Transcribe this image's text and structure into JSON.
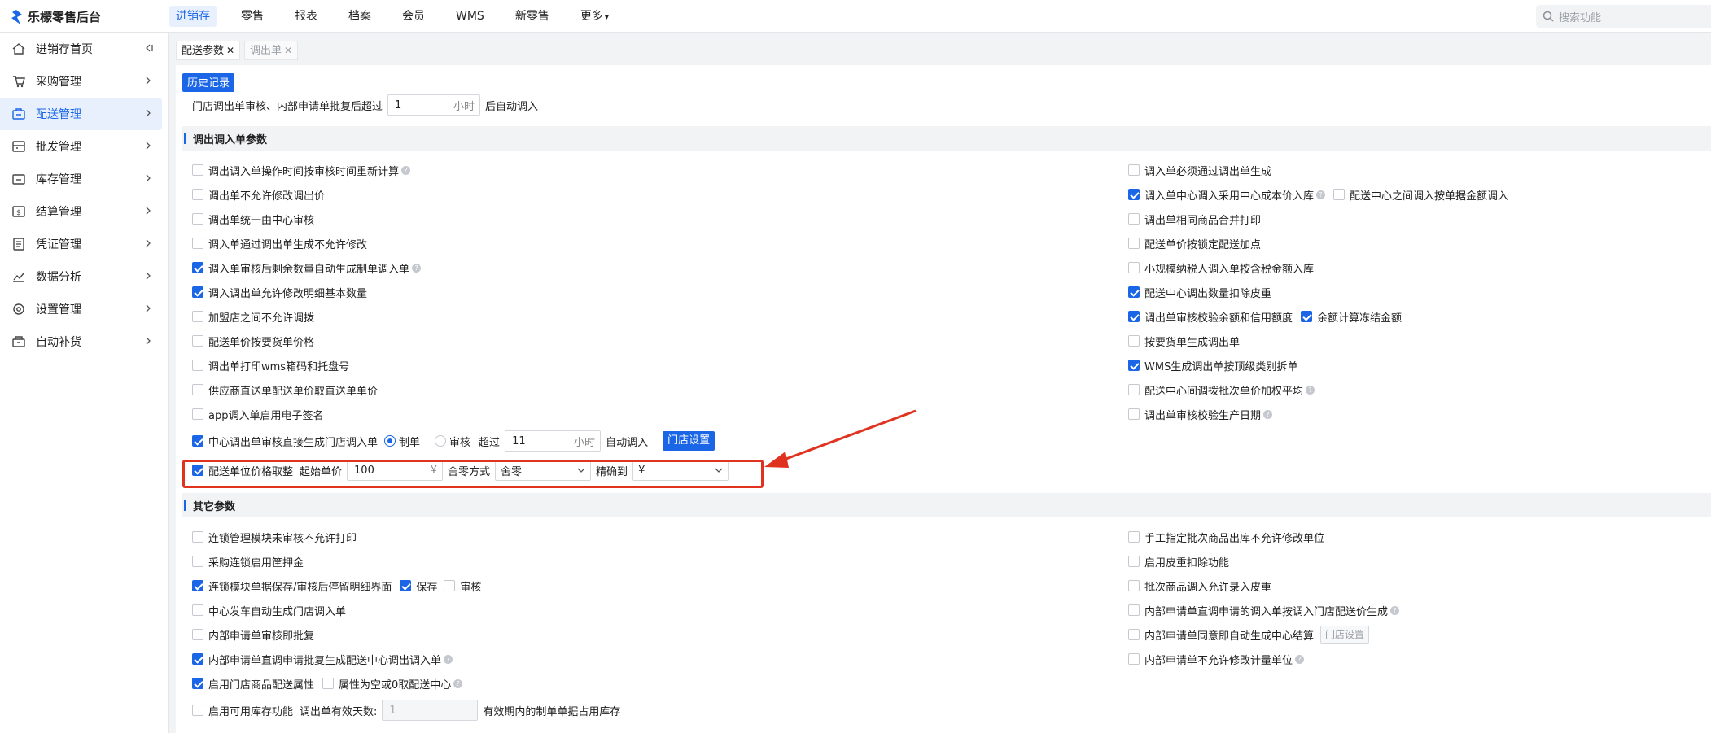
{
  "app": {
    "title": "乐檬零售后台"
  },
  "topnav": [
    {
      "label": "进销存",
      "active": true
    },
    {
      "label": "零售"
    },
    {
      "label": "报表"
    },
    {
      "label": "档案"
    },
    {
      "label": "会员"
    },
    {
      "label": "WMS"
    },
    {
      "label": "新零售"
    },
    {
      "label": "更多"
    }
  ],
  "search": {
    "placeholder": "搜索功能"
  },
  "sidebar": [
    {
      "label": "进销存首页",
      "icon": "home-icon"
    },
    {
      "label": "采购管理",
      "icon": "cart-icon"
    },
    {
      "label": "配送管理",
      "icon": "delivery-icon",
      "active": true
    },
    {
      "label": "批发管理",
      "icon": "wholesale-icon"
    },
    {
      "label": "库存管理",
      "icon": "inventory-icon"
    },
    {
      "label": "结算管理",
      "icon": "settlement-icon"
    },
    {
      "label": "凭证管理",
      "icon": "voucher-icon"
    },
    {
      "label": "数据分析",
      "icon": "chart-icon"
    },
    {
      "label": "设置管理",
      "icon": "settings-icon"
    },
    {
      "label": "自动补货",
      "icon": "replenish-icon"
    }
  ],
  "tabs": [
    {
      "label": "配送参数",
      "active": true
    },
    {
      "label": "调出单"
    }
  ],
  "history_button": "历史记录",
  "auto_in": {
    "prefix": "门店调出单审核、内部申请单批复后超过",
    "value": "1",
    "unit": "小时",
    "suffix": "后自动调入"
  },
  "section1": {
    "title": "调出调入单参数"
  },
  "left1": [
    {
      "label": "调出调入单操作时间按审核时间重新计算",
      "checked": false,
      "help": true
    },
    {
      "label": "调出单不允许修改调出价",
      "checked": false
    },
    {
      "label": "调出单统一由中心审核",
      "checked": false
    },
    {
      "label": "调入单通过调出单生成不允许修改",
      "checked": false
    },
    {
      "label": "调入单审核后剩余数量自动生成制单调入单",
      "checked": true,
      "help": true
    },
    {
      "label": "调入调出单允许修改明细基本数量",
      "checked": true
    },
    {
      "label": "加盟店之间不允许调拨",
      "checked": false
    },
    {
      "label": "配送单价按要货单价格",
      "checked": false
    },
    {
      "label": "调出单打印wms箱码和托盘号",
      "checked": false
    },
    {
      "label": "供应商直送单配送单价取直送单单价",
      "checked": false
    },
    {
      "label": "app调入单启用电子签名",
      "checked": false
    }
  ],
  "right1": [
    {
      "label": "调入单必须通过调出单生成",
      "checked": false
    },
    {
      "label": "调入单中心调入采用中心成本价入库",
      "checked": true,
      "help": true,
      "extra": {
        "label": "配送中心之间调入按单据金额调入",
        "checked": false
      }
    },
    {
      "label": "调出单相同商品合并打印",
      "checked": false
    },
    {
      "label": "配送单价按锁定配送加点",
      "checked": false
    },
    {
      "label": "小规模纳税人调入单按含税金额入库",
      "checked": false
    },
    {
      "label": "配送中心调出数量扣除皮重",
      "checked": true
    },
    {
      "label": "调出单审核校验余额和信用额度",
      "checked": true,
      "extra": {
        "label": "余额计算冻结金额",
        "checked": true
      }
    },
    {
      "label": "按要货单生成调出单",
      "checked": false
    },
    {
      "label": "WMS生成调出单按顶级类别拆单",
      "checked": true
    },
    {
      "label": "配送中心间调拨批次单价加权平均",
      "checked": false,
      "help": true
    },
    {
      "label": "调出单审核校验生产日期",
      "checked": false,
      "help": true
    }
  ],
  "center_row": {
    "label": "中心调出单审核直接生成门店调入单",
    "checked": true,
    "radio1": "制单",
    "radio2": "审核",
    "over": "超过",
    "value": "11",
    "unit": "小时",
    "suffix": "自动调入",
    "button": "门店设置"
  },
  "price_row": {
    "label": "配送单位价格取整",
    "checked": true,
    "start_label": "起始单价",
    "start_value": "100",
    "currency": "¥",
    "mode_label": "舍零方式",
    "mode_value": "舍零",
    "precision_label": "精确到",
    "precision_value": "¥"
  },
  "section2": {
    "title": "其它参数"
  },
  "left2": [
    {
      "label": "连锁管理模块未审核不允许打印",
      "checked": false
    },
    {
      "label": "采购连锁启用筐押金",
      "checked": false
    },
    {
      "label": "连锁模块单据保存/审核后停留明细界面",
      "checked": true,
      "extra": {
        "label": "保存",
        "checked": true
      },
      "extra2": {
        "label": "审核",
        "checked": false
      }
    },
    {
      "label": "中心发车自动生成门店调入单",
      "checked": false
    },
    {
      "label": "内部申请单审核即批复",
      "checked": false
    },
    {
      "label": "内部申请单直调申请批复生成配送中心调出调入单",
      "checked": true,
      "help": true
    },
    {
      "label": "启用门店商品配送属性",
      "checked": true,
      "extra": {
        "label": "属性为空或0取配送中心",
        "checked": false,
        "help": true
      }
    }
  ],
  "stock_row": {
    "label": "启用可用库存功能",
    "checked": false,
    "days_label": "调出单有效天数:",
    "days_value": "1",
    "suffix": "有效期内的制单单据占用库存"
  },
  "right2": [
    {
      "label": "手工指定批次商品出库不允许修改单位",
      "checked": false
    },
    {
      "label": "启用皮重扣除功能",
      "checked": false
    },
    {
      "label": "批次商品调入允许录入皮重",
      "checked": false
    },
    {
      "label": "内部申请单直调申请的调入单按调入门店配送价生成",
      "checked": false,
      "help": true
    },
    {
      "label": "内部申请单同意即自动生成中心结算",
      "checked": false,
      "button": "门店设置"
    },
    {
      "label": "内部申请单不允许修改计量单位",
      "checked": false,
      "help": true
    }
  ],
  "colors": {
    "accent": "#1a66e6",
    "highlight": "#e0331f"
  }
}
